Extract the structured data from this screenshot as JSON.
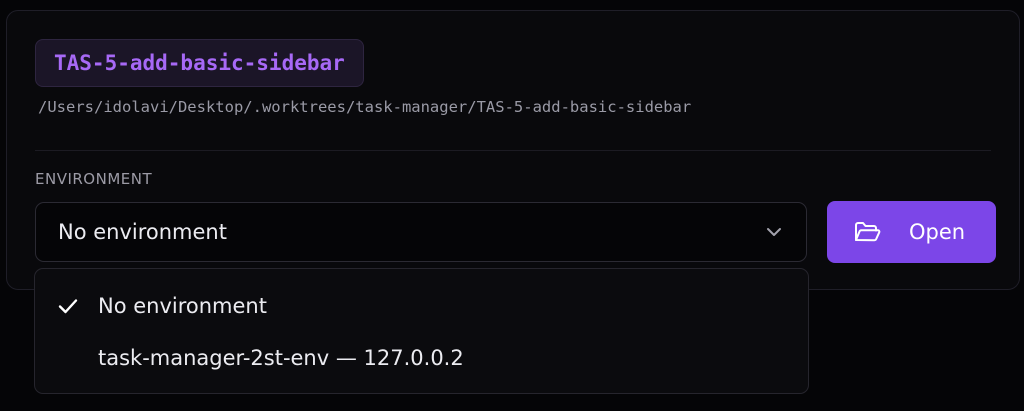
{
  "worktree": {
    "branch_name": "TAS-5-add-basic-sidebar",
    "path": "/Users/idolavi/Desktop/.worktrees/task-manager/TAS-5-add-basic-sidebar"
  },
  "environment": {
    "section_label": "ENVIRONMENT",
    "selected_value": "No environment",
    "chevron_icon": "chevron-down-icon",
    "options": [
      {
        "label": "No environment",
        "selected": true
      },
      {
        "label": "task-manager-2st-env — 127.0.0.2",
        "selected": false
      }
    ]
  },
  "open_button": {
    "label": "Open",
    "icon": "folder-open-icon"
  },
  "colors": {
    "accent": "#7c46e8",
    "branch_text": "#a769f6",
    "branch_bg": "#1b1527"
  }
}
